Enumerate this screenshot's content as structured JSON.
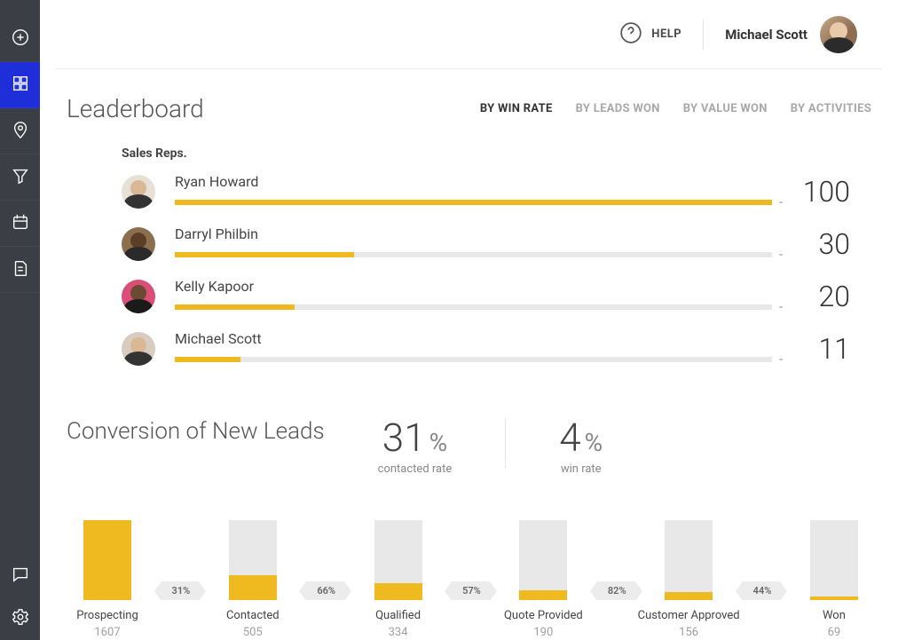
{
  "header": {
    "help_label": "HELP",
    "user_name": "Michael Scott"
  },
  "leaderboard": {
    "title": "Leaderboard",
    "tabs": [
      {
        "label": "BY WIN RATE",
        "active": true
      },
      {
        "label": "BY LEADS WON",
        "active": false
      },
      {
        "label": "BY VALUE WON",
        "active": false
      },
      {
        "label": "BY ACTIVITIES",
        "active": false
      }
    ],
    "reps_header": "Sales Reps.",
    "reps": [
      {
        "name": "Ryan Howard",
        "value": 100,
        "pct": 100
      },
      {
        "name": "Darryl Philbin",
        "value": 30,
        "pct": 30
      },
      {
        "name": "Kelly Kapoor",
        "value": 20,
        "pct": 20
      },
      {
        "name": "Michael Scott",
        "value": 11,
        "pct": 11
      }
    ]
  },
  "conversion": {
    "title": "Conversion of New Leads",
    "contacted_rate": "31",
    "contacted_label": "contacted rate",
    "win_rate": "4",
    "win_label": "win rate",
    "pct_symbol": "%"
  },
  "funnel": {
    "stages": [
      {
        "label": "Prospecting",
        "count": 1607,
        "fill_pct": 100
      },
      {
        "label": "Contacted",
        "count": 505,
        "fill_pct": 31
      },
      {
        "label": "Qualified",
        "count": 334,
        "fill_pct": 21
      },
      {
        "label": "Quote Provided",
        "count": 190,
        "fill_pct": 12
      },
      {
        "label": "Customer Approved",
        "count": 156,
        "fill_pct": 10
      },
      {
        "label": "Won",
        "count": 69,
        "fill_pct": 4
      }
    ],
    "arrows": [
      "31%",
      "66%",
      "57%",
      "82%",
      "44%"
    ]
  },
  "chart_data": [
    {
      "type": "bar",
      "title": "Leaderboard — By Win Rate",
      "categories": [
        "Ryan Howard",
        "Darryl Philbin",
        "Kelly Kapoor",
        "Michael Scott"
      ],
      "values": [
        100,
        30,
        20,
        11
      ],
      "xlabel": "Sales Reps.",
      "ylabel": "Win rate",
      "ylim": [
        0,
        100
      ]
    },
    {
      "type": "bar",
      "title": "Conversion of New Leads",
      "categories": [
        "Prospecting",
        "Contacted",
        "Qualified",
        "Quote Provided",
        "Customer Approved",
        "Won"
      ],
      "values": [
        1607,
        505,
        334,
        190,
        156,
        69
      ],
      "annotations": [
        "31%",
        "66%",
        "57%",
        "82%",
        "44%"
      ],
      "summary": {
        "contacted_rate_pct": 31,
        "win_rate_pct": 4
      }
    }
  ]
}
